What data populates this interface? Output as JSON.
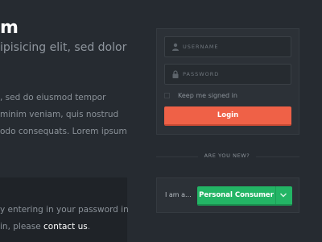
{
  "hero": {
    "title": "m",
    "subtitle": "ipisicing elit, sed dolor"
  },
  "body_lines": [
    ", sed do eiusmod tempor",
    "minim veniam, quis nostrud",
    "odo consequats. Lorem ipsum"
  ],
  "notice": {
    "line1": "y entering in your password in",
    "line2_prefix": " in, please ",
    "link": "contact us",
    "line2_suffix": "."
  },
  "login": {
    "username_placeholder": "USERNAME",
    "password_placeholder": "PASSWORD",
    "remember_label": "Keep me signed in",
    "button_label": "Login"
  },
  "divider": {
    "text": "ARE YOU NEW?"
  },
  "signup": {
    "iam_label": "I am a...",
    "selected_option": "Personal Consumer"
  },
  "colors": {
    "background": "#262b31",
    "panel": "#2c3137",
    "accent_login": "#ef6147",
    "accent_select": "#23b565"
  },
  "icons": {
    "username": "user-icon",
    "password": "lock-icon",
    "dropdown": "chevron-down-icon"
  }
}
